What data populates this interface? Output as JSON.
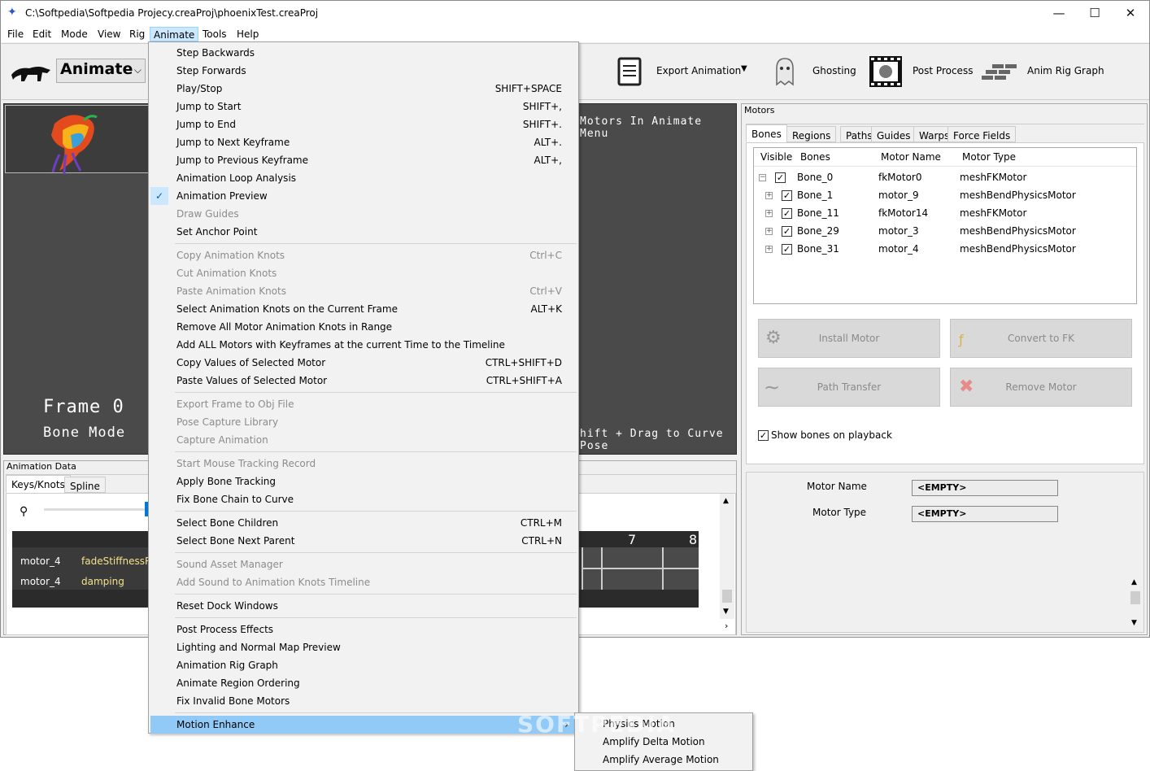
{
  "window": {
    "title": "C:\\Softpedia\\Softpedia Projecy.creaProj\\phoenixTest.creaProj",
    "min": "—",
    "max": "☐",
    "close": "✕"
  },
  "menubar": [
    "File",
    "Edit",
    "Mode",
    "View",
    "Rig",
    "Animate",
    "Tools",
    "Help"
  ],
  "toolbar": {
    "mode_value": "Animate",
    "export_label": "Export Animation",
    "ghosting_label": "Ghosting",
    "postprocess_label": "Post Process",
    "rig_graph_label": "Anim Rig Graph"
  },
  "viewport": {
    "hint_top": "Motors In Animate Menu",
    "frame_label": "Frame 0",
    "mode_label": "Bone Mode",
    "hint_bottom": "hift + Drag to Curve Pose"
  },
  "anim_data": {
    "title": "Animation Data",
    "tabs": [
      "Keys/Knots",
      "Spline"
    ],
    "timeline_numbers": [
      "7",
      "8"
    ],
    "rows": [
      {
        "motor": "motor_4",
        "property": "fadeStiffnessRa"
      },
      {
        "motor": "motor_4",
        "property": "damping"
      }
    ]
  },
  "motors": {
    "title": "Motors",
    "tabs": [
      "Bones",
      "Regions",
      "Paths",
      "Guides",
      "Warps",
      "Force Fields"
    ],
    "columns": [
      "Visible",
      "Bones",
      "Motor Name",
      "Motor Type"
    ],
    "rows": [
      {
        "bone": "Bone_0",
        "motor": "fkMotor0",
        "type": "meshFKMotor",
        "expander": "⊟"
      },
      {
        "bone": "Bone_1",
        "motor": "motor_9",
        "type": "meshBendPhysicsMotor",
        "expander": "⊞"
      },
      {
        "bone": "Bone_11",
        "motor": "fkMotor14",
        "type": "meshFKMotor",
        "expander": "⊞"
      },
      {
        "bone": "Bone_29",
        "motor": "motor_3",
        "type": "meshBendPhysicsMotor",
        "expander": "⊞"
      },
      {
        "bone": "Bone_31",
        "motor": "motor_4",
        "type": "meshBendPhysicsMotor",
        "expander": "⊞"
      }
    ],
    "buttons": {
      "install": "Install Motor",
      "convert": "Convert to FK",
      "path": "Path Transfer",
      "remove": "Remove Motor"
    },
    "show_bones_label": "Show bones on playback",
    "motor_name_label": "Motor Name",
    "motor_name_value": "<EMPTY>",
    "motor_type_label": "Motor Type",
    "motor_type_value": "<EMPTY>"
  },
  "animate_menu": [
    {
      "label": "Step Backwards",
      "shortcut": "",
      "disabled": false
    },
    {
      "label": "Step Forwards",
      "shortcut": "",
      "disabled": false
    },
    {
      "label": "Play/Stop",
      "shortcut": "SHIFT+SPACE",
      "disabled": false
    },
    {
      "label": "Jump to Start",
      "shortcut": "SHIFT+,",
      "disabled": false
    },
    {
      "label": "Jump to End",
      "shortcut": "SHIFT+.",
      "disabled": false
    },
    {
      "label": "Jump to Next Keyframe",
      "shortcut": "ALT+.",
      "disabled": false
    },
    {
      "label": "Jump to Previous Keyframe",
      "shortcut": "ALT+,",
      "disabled": false
    },
    {
      "label": "Animation Loop Analysis",
      "shortcut": "",
      "disabled": false
    },
    {
      "label": "Animation Preview",
      "shortcut": "",
      "disabled": false,
      "checked": true
    },
    {
      "label": "Draw Guides",
      "shortcut": "",
      "disabled": true
    },
    {
      "label": "Set Anchor Point",
      "shortcut": "",
      "disabled": false,
      "sep_after": true
    },
    {
      "label": "Copy Animation Knots",
      "shortcut": "Ctrl+C",
      "disabled": true
    },
    {
      "label": "Cut Animation Knots",
      "shortcut": "",
      "disabled": true
    },
    {
      "label": "Paste Animation Knots",
      "shortcut": "Ctrl+V",
      "disabled": true
    },
    {
      "label": "Select Animation Knots on the Current Frame",
      "shortcut": "ALT+K",
      "disabled": false
    },
    {
      "label": "Remove All Motor Animation Knots in Range",
      "shortcut": "",
      "disabled": false
    },
    {
      "label": "Add ALL Motors with Keyframes at the current Time to the Timeline",
      "shortcut": "",
      "disabled": false
    },
    {
      "label": "Copy Values of Selected Motor",
      "shortcut": "CTRL+SHIFT+D",
      "disabled": false
    },
    {
      "label": "Paste Values of Selected Motor",
      "shortcut": "CTRL+SHIFT+A",
      "disabled": false,
      "sep_after": true
    },
    {
      "label": "Export Frame to Obj File",
      "shortcut": "",
      "disabled": true
    },
    {
      "label": "Pose Capture Library",
      "shortcut": "",
      "disabled": true
    },
    {
      "label": "Capture Animation",
      "shortcut": "",
      "disabled": true,
      "sep_after": true
    },
    {
      "label": "Start Mouse Tracking Record",
      "shortcut": "",
      "disabled": true
    },
    {
      "label": "Apply Bone Tracking",
      "shortcut": "",
      "disabled": false
    },
    {
      "label": "Fix Bone Chain to Curve",
      "shortcut": "",
      "disabled": false,
      "sep_after": true
    },
    {
      "label": "Select Bone Children",
      "shortcut": "CTRL+M",
      "disabled": false
    },
    {
      "label": "Select Bone Next Parent",
      "shortcut": "CTRL+N",
      "disabled": false,
      "sep_after": true
    },
    {
      "label": "Sound Asset Manager",
      "shortcut": "",
      "disabled": true
    },
    {
      "label": "Add Sound to Animation Knots Timeline",
      "shortcut": "",
      "disabled": true,
      "sep_after": true
    },
    {
      "label": "Reset Dock Windows",
      "shortcut": "",
      "disabled": false,
      "sep_after": true
    },
    {
      "label": "Post Process Effects",
      "shortcut": "",
      "disabled": false
    },
    {
      "label": "Lighting and Normal Map Preview",
      "shortcut": "",
      "disabled": false
    },
    {
      "label": "Animation Rig Graph",
      "shortcut": "",
      "disabled": false
    },
    {
      "label": "Animate Region Ordering",
      "shortcut": "",
      "disabled": false
    },
    {
      "label": "Fix Invalid Bone Motors",
      "shortcut": "",
      "disabled": false,
      "sep_after": true
    },
    {
      "label": "Motion Enhance",
      "shortcut": "",
      "disabled": false,
      "highlighted": true,
      "submenu": true
    }
  ],
  "motion_enhance_submenu": [
    "Physics Motion",
    "Amplify Delta Motion",
    "Amplify Average Motion"
  ],
  "watermark": "SOFTPEDIA",
  "colors": {
    "menu_highlight": "#91c9f7",
    "viewport_bg": "#4a4a4a",
    "property_text": "#f3e28a"
  }
}
